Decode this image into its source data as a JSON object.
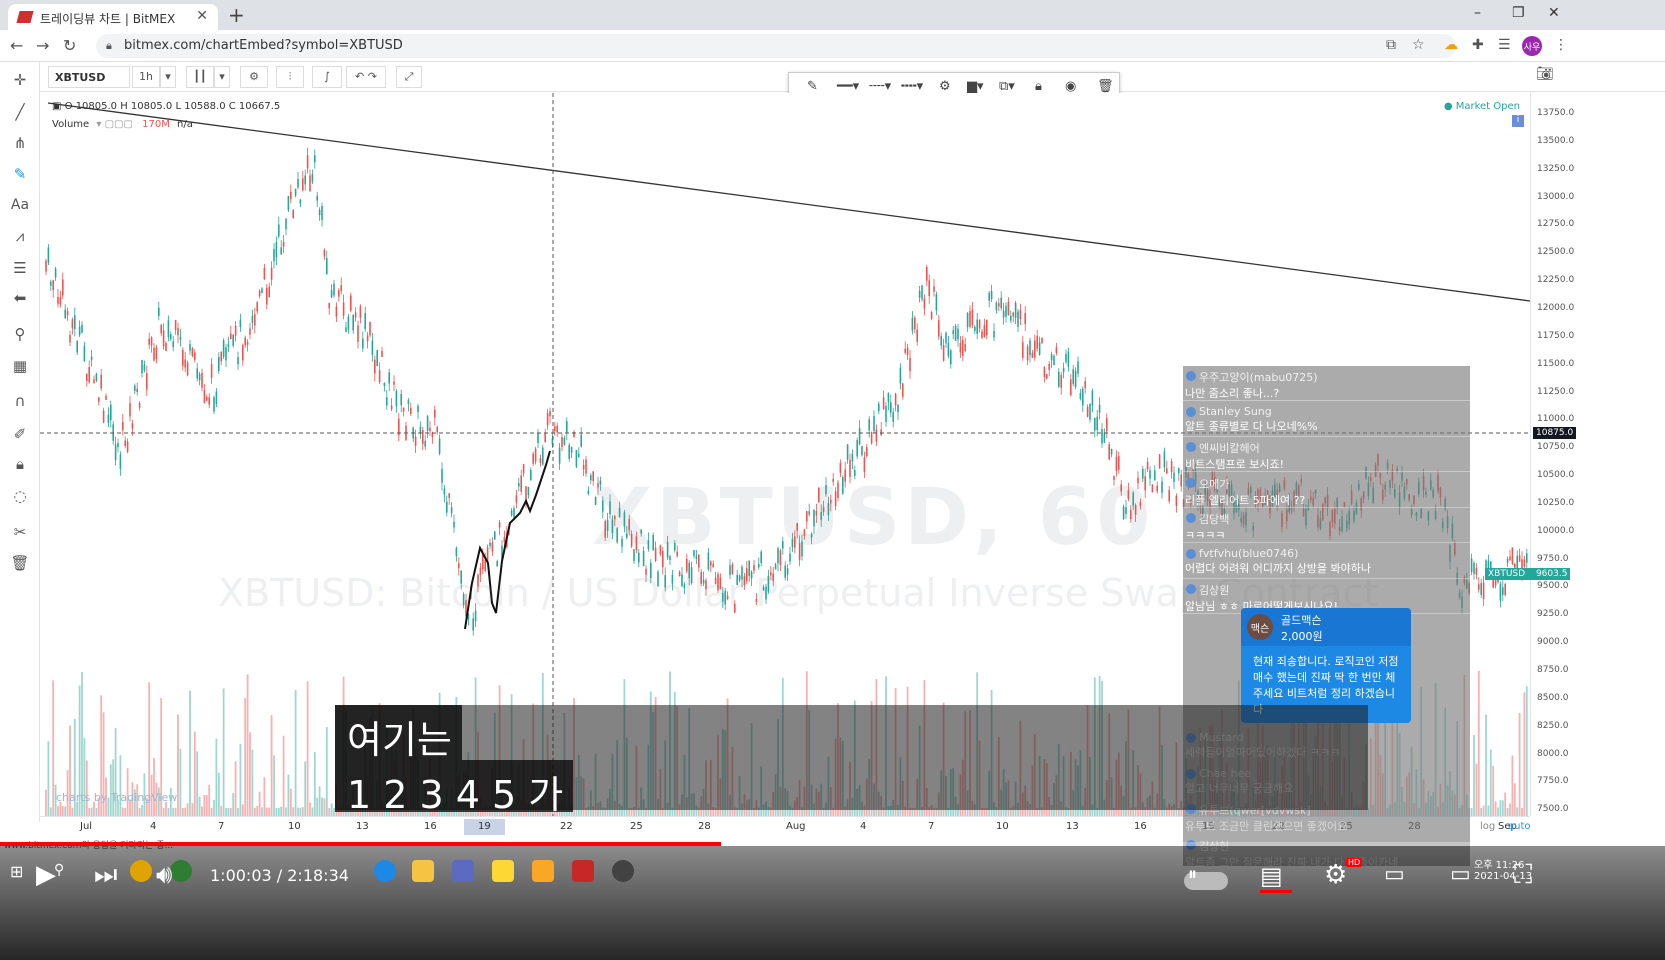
{
  "browser": {
    "tab_title": "트레이딩뷰 차트 | BitMEX",
    "tab_close": "✕",
    "new_tab": "+",
    "url": "bitmex.com/chartEmbed?symbol=XBTUSD",
    "window_controls": [
      "–",
      "❐",
      "✕"
    ],
    "profile_initials": "사우"
  },
  "chart_toolbar": {
    "symbol": "XBTUSD",
    "interval": "1h"
  },
  "legend": {
    "ohlc": "O 10805.0  H 10805.0  L 10588.0  C 10667.5",
    "volume_label": "Volume",
    "volume_value": "170M",
    "volume_na": "n/a"
  },
  "watermark": {
    "title": "XBTUSD, 60",
    "subtitle": "XBTUSD: Bitcoin / US Dollar Perpetual Inverse Swap Contract"
  },
  "market_status": "● Market Open",
  "credit": "charts by TradingView",
  "price_axis": {
    "ticks": [
      "13750.0",
      "13500.0",
      "13250.0",
      "13000.0",
      "12750.0",
      "12500.0",
      "12250.0",
      "12000.0",
      "11750.0",
      "11500.0",
      "11250.0",
      "11000.0",
      "10750.0",
      "10500.0",
      "10250.0",
      "10000.0",
      "9750.0",
      "9500.0",
      "9250.0",
      "9000.0",
      "8750.0",
      "8500.0",
      "8250.0",
      "8000.0",
      "7750.0",
      "7500.0"
    ],
    "crosshair_price": "10875.0",
    "last_price_label": "XBTUSD",
    "last_price": "9603.5",
    "colors": {
      "crosshair_tag": "#131722",
      "last_price_tag": "#26a69a"
    }
  },
  "time_axis": {
    "ticks": [
      "Jul",
      "4",
      "7",
      "10",
      "13",
      "16",
      "19",
      "22",
      "25",
      "28",
      "Aug",
      "4",
      "7",
      "10",
      "13",
      "16",
      "19",
      "22",
      "25",
      "28",
      "Sep"
    ],
    "highlighted": "19",
    "log_label": "log",
    "auto_label": "auto"
  },
  "chat": {
    "messages": [
      {
        "author": "우주고양이(mabu0725)",
        "text": "나만 줌소리 좋나...?"
      },
      {
        "author": "Stanley Sung",
        "text": "알트 종류별로 다 나오네%%"
      },
      {
        "author": "엔씨비칼헤어",
        "text": "비트스탬프로 보시죠!"
      },
      {
        "author": "오메가",
        "text": "리플 엘리어트 5파에여 ??"
      },
      {
        "author": "김당백",
        "text": "ㅋㅋㅋㅋ"
      },
      {
        "author": "fvtfvhu(blue0746)",
        "text": "어렵다 어려워 어디까지 상방을 봐야하나"
      },
      {
        "author": "김상원",
        "text": "알남님 ㅎㅎ 마로어떻게보시나요!"
      }
    ],
    "superchat": {
      "avatar": "맥슨",
      "name": "골드맥슨",
      "amount": "2,000원",
      "text": "현재 죄송합니다. 로직코인 저점매수 했는데 진짜 딱 한 번만 체주세요 비트처럼 정리 하겠습니다"
    },
    "faded_messages": [
      {
        "author": "Mustard",
        "text": "세력들이얼마어딨어하겠다 ㅋㅋㅋ"
      },
      {
        "author": "Chae hee",
        "text": "알고 너무너무 궁금해요"
      },
      {
        "author": "유투브(qwer[vdvwsk]",
        "text": "유투브 조금만 클린했으면 좋겠어요"
      },
      {
        "author": "김상현",
        "text": "알트좀 그만 질문해라 진짜 내가 다 짜증이카네"
      }
    ]
  },
  "subtitles": {
    "line1": "여기는",
    "line2": "1 2 3 4 5 가"
  },
  "youtube": {
    "current_time": "1:00:03",
    "duration": "2:18:34",
    "time_display": "1:00:03 / 2:18:34",
    "progress_fraction": 0.4329,
    "status_text": "www.bitmex.com의 응답을 기다리는 중...",
    "hd_badge": "HD"
  },
  "system_tray": {
    "time": "오후 11:26",
    "date": "2021-04-13"
  }
}
